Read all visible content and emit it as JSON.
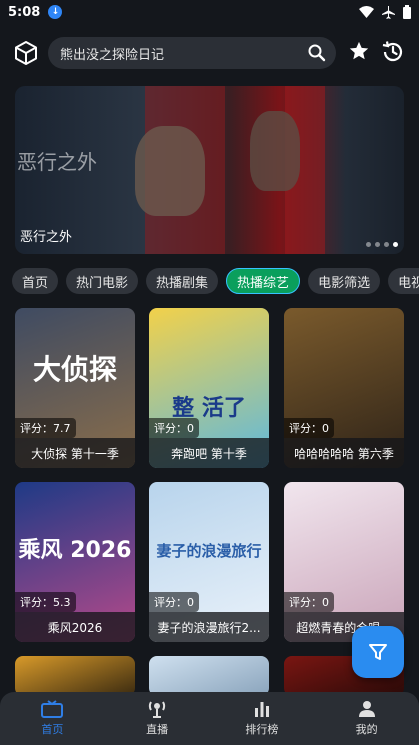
{
  "status_bar": {
    "time": "5:08"
  },
  "header": {
    "search_value": "熊出没之探险日记"
  },
  "banner": {
    "faint_title": "恶行之外",
    "caption": "恶行之外",
    "dots": 4,
    "active_dot": 4
  },
  "tabs": [
    {
      "label": "首页",
      "active": false
    },
    {
      "label": "热门电影",
      "active": false
    },
    {
      "label": "热播剧集",
      "active": false
    },
    {
      "label": "热播综艺",
      "active": true
    },
    {
      "label": "电影筛选",
      "active": false
    },
    {
      "label": "电视",
      "active": false
    }
  ],
  "cards": [
    {
      "title": "大侦探 第十一季",
      "rating": "评分：7.7",
      "poster_text": "大侦探",
      "colors": [
        "#3f4b62",
        "#8b6e4a"
      ]
    },
    {
      "title": "奔跑吧 第十季",
      "rating": "评分：0",
      "poster_text": "整 活了",
      "colors": [
        "#f2d14a",
        "#5cb8e0"
      ]
    },
    {
      "title": "哈哈哈哈哈 第六季",
      "rating": "评分：0",
      "poster_text": "",
      "colors": [
        "#7a5a2c",
        "#2e2318"
      ]
    },
    {
      "title": "乘风2026",
      "rating": "评分：5.3",
      "poster_text": "乘风 2026",
      "colors": [
        "#1e3a86",
        "#b84a8a"
      ]
    },
    {
      "title": "妻子的浪漫旅行2...",
      "rating": "评分：0",
      "poster_text": "妻子的浪漫旅行",
      "colors": [
        "#b8d4ec",
        "#eaf2fa"
      ]
    },
    {
      "title": "超燃青春的合唱...",
      "rating": "评分：0",
      "poster_text": "",
      "colors": [
        "#f1e6ee",
        "#c9a3b8"
      ]
    },
    {
      "title": "",
      "rating": "",
      "poster_text": "",
      "colors": [
        "#d89a2a",
        "#3a2a10"
      ]
    },
    {
      "title": "",
      "rating": "",
      "poster_text": "",
      "colors": [
        "#cfe0ef",
        "#8aa4bc"
      ]
    },
    {
      "title": "",
      "rating": "",
      "poster_text": "",
      "colors": [
        "#7a1612",
        "#2a0a08"
      ]
    }
  ],
  "bottom_nav": [
    {
      "label": "首页",
      "icon": "home-tv-icon",
      "active": true
    },
    {
      "label": "直播",
      "icon": "live-icon",
      "active": false
    },
    {
      "label": "排行榜",
      "icon": "chart-icon",
      "active": false
    },
    {
      "label": "我的",
      "icon": "user-icon",
      "active": false
    }
  ],
  "colors": {
    "accent": "#2a8cf0",
    "active_tab": "#0a9f5c"
  }
}
